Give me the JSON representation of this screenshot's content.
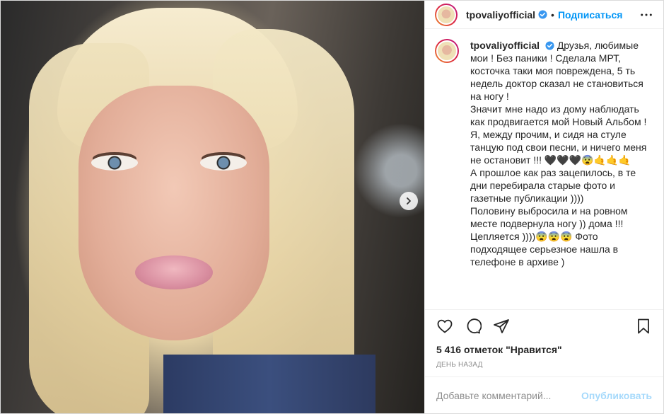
{
  "post": {
    "username": "tpovaliyofficial",
    "follow_label": "Подписаться",
    "separator": "•",
    "caption": "Друзья, любимые мои ! Без паники ! Сделала МРТ, косточка таки моя повреждена, 5 ть недель доктор сказал не становиться на ногу !\nЗначит мне надо из дому наблюдать как продвигается мой Новый Альбом !\nЯ, между прочим, и сидя на стуле танцую под свои песни, и ничего меня не остановит !!! 🖤🖤🖤😨🤙🤙🤙\nА прошлое как раз зацепилось, в те дни перебирала старые фото и газетные публикации ))))\nПоловину выбросила и на ровном месте подвернула ногу )) дома !!! Цепляется ))))😨😨😨 Фото подходящее серьезное нашла в телефоне в архиве )",
    "likes_count": "5 416",
    "likes_word": "отметок \"Нравится\"",
    "timestamp": "день назад",
    "comment_placeholder": "Добавьте комментарий...",
    "publish_label": "Опубликовать"
  },
  "icons": {
    "verified": "verified-badge-icon",
    "more": "more-options-icon",
    "next": "chevron-right-icon",
    "like": "heart-icon",
    "comment": "comment-bubble-icon",
    "share": "paper-plane-icon",
    "save": "bookmark-icon"
  },
  "colors": {
    "accent": "#0095f6",
    "text": "#262626",
    "muted": "#8e8e8e",
    "border": "#efefef"
  }
}
